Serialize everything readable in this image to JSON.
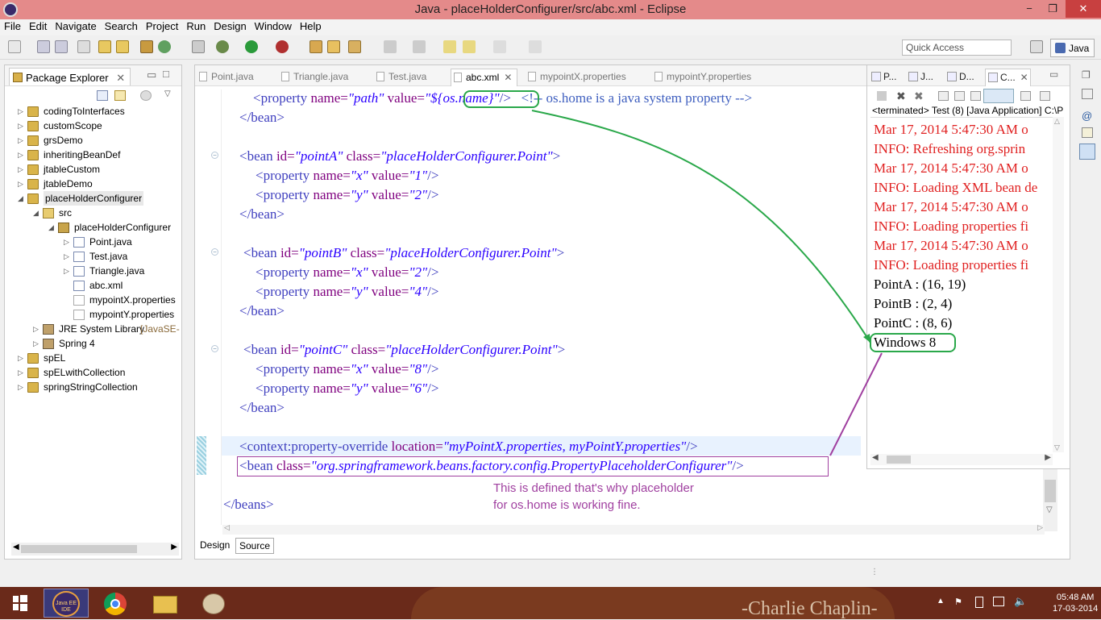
{
  "window": {
    "title": "Java - placeHolderConfigurer/src/abc.xml - Eclipse",
    "minimize": "−",
    "maximize": "❐",
    "close": "✕"
  },
  "menu": [
    "File",
    "Edit",
    "Navigate",
    "Search",
    "Project",
    "Run",
    "Design",
    "Window",
    "Help"
  ],
  "toolbar": {
    "quick_access_placeholder": "Quick Access",
    "perspective": "Java"
  },
  "package_explorer": {
    "title": "Package Explorer",
    "items": [
      {
        "label": "codingToInterfaces",
        "level": 0,
        "arrow": "▷",
        "icon": "proj"
      },
      {
        "label": "customScope",
        "level": 0,
        "arrow": "▷",
        "icon": "proj"
      },
      {
        "label": "grsDemo",
        "level": 0,
        "arrow": "▷",
        "icon": "proj"
      },
      {
        "label": "inheritingBeanDef",
        "level": 0,
        "arrow": "▷",
        "icon": "proj"
      },
      {
        "label": "jtableCustom",
        "level": 0,
        "arrow": "▷",
        "icon": "proj"
      },
      {
        "label": "jtableDemo",
        "level": 0,
        "arrow": "▷",
        "icon": "proj"
      },
      {
        "label": "placeHolderConfigurer",
        "level": 0,
        "arrow": "◢",
        "icon": "proj"
      },
      {
        "label": "src",
        "level": 1,
        "arrow": "◢",
        "icon": "srcf"
      },
      {
        "label": "placeHolderConfigurer",
        "level": 2,
        "arrow": "◢",
        "icon": "pkg"
      },
      {
        "label": "Point.java",
        "level": 3,
        "arrow": "▷",
        "icon": "java"
      },
      {
        "label": "Test.java",
        "level": 3,
        "arrow": "▷",
        "icon": "java"
      },
      {
        "label": "Triangle.java",
        "level": 3,
        "arrow": "▷",
        "icon": "java"
      },
      {
        "label": "abc.xml",
        "level": 3,
        "arrow": "",
        "icon": "xml"
      },
      {
        "label": "mypointX.properties",
        "level": 3,
        "arrow": "",
        "icon": "prop"
      },
      {
        "label": "mypointY.properties",
        "level": 3,
        "arrow": "",
        "icon": "prop"
      },
      {
        "label": "JRE System Library",
        "extra": "[JavaSE-",
        "level": 1,
        "arrow": "▷",
        "icon": "lib"
      },
      {
        "label": "Spring 4",
        "level": 1,
        "arrow": "▷",
        "icon": "lib"
      },
      {
        "label": "spEL",
        "level": 0,
        "arrow": "▷",
        "icon": "proj"
      },
      {
        "label": "spELwithCollection",
        "level": 0,
        "arrow": "▷",
        "icon": "proj"
      },
      {
        "label": "springStringCollection",
        "level": 0,
        "arrow": "▷",
        "icon": "proj"
      }
    ]
  },
  "editor": {
    "tabs": [
      "Point.java",
      "Triangle.java",
      "Test.java",
      "abc.xml",
      "mypointX.properties",
      "mypointY.properties"
    ],
    "active_tab": "abc.xml",
    "bottom_tabs": [
      "Design",
      "Source"
    ],
    "code": {
      "l1": {
        "indent": "    ",
        "open": "<property ",
        "a1": "name=",
        "v1": "\"path\"",
        "a2": " value=",
        "v2a": "\"",
        "v2b": "${os.name}",
        "v2c": "\"",
        "close": "/>",
        "comment": "   <!-- os.home is a java system property -->"
      },
      "l2": "</bean>",
      "beanA": {
        "open": "<bean ",
        "a1": "id=",
        "v1": "\"pointA\"",
        "a2": " class=",
        "v2": "\"placeHolderConfigurer.Point\"",
        "close": ">"
      },
      "pA1": {
        "open": "<property ",
        "a1": "name=",
        "v1": "\"x\"",
        "a2": " value=",
        "v2": "\"1\"",
        "close": "/>"
      },
      "pA2": {
        "open": "<property ",
        "a1": "name=",
        "v1": "\"y\"",
        "a2": " value=",
        "v2": "\"2\"",
        "close": "/>"
      },
      "endA": "</bean>",
      "beanB": {
        "open": "<bean ",
        "a1": "id=",
        "v1": "\"pointB\"",
        "a2": " class=",
        "v2": "\"placeHolderConfigurer.Point\"",
        "close": ">"
      },
      "pB1": {
        "open": "<property ",
        "a1": "name=",
        "v1": "\"x\"",
        "a2": " value=",
        "v2": "\"2\"",
        "close": "/>"
      },
      "pB2": {
        "open": "<property ",
        "a1": "name=",
        "v1": "\"y\"",
        "a2": " value=",
        "v2": "\"4\"",
        "close": "/>"
      },
      "endB": "</bean>",
      "beanC": {
        "open": "<bean ",
        "a1": "id=",
        "v1": "\"pointC\"",
        "a2": " class=",
        "v2": "\"placeHolderConfigurer.Point\"",
        "close": ">"
      },
      "pC1": {
        "open": "<property ",
        "a1": "name=",
        "v1": "\"x\"",
        "a2": " value=",
        "v2": "\"8\"",
        "close": "/>"
      },
      "pC2": {
        "open": "<property ",
        "a1": "name=",
        "v1": "\"y\"",
        "a2": " value=",
        "v2": "\"6\"",
        "close": "/>"
      },
      "endC": "</bean>",
      "ctx": {
        "open": "<context:property-override ",
        "a1": "location=",
        "v1": "\"myPointX.properties, myPointY.properties\"",
        "close": "/>"
      },
      "phc": {
        "open": "<bean ",
        "a1": "class=",
        "v1": "\"org.springframework.beans.factory.config.PropertyPlaceholderConfigurer\"",
        "close": "/>"
      },
      "endBeans": "</beans>"
    }
  },
  "console": {
    "tabs": [
      "P...",
      "J...",
      "D...",
      "C..."
    ],
    "header": "<terminated> Test (8) [Java Application] C:\\P",
    "lines": [
      {
        "text": "Mar 17, 2014 5:47:30 AM o",
        "color": "red"
      },
      {
        "text": "INFO: Refreshing org.sprin",
        "color": "red"
      },
      {
        "text": "Mar 17, 2014 5:47:30 AM o",
        "color": "red"
      },
      {
        "text": "INFO: Loading XML bean de",
        "color": "red"
      },
      {
        "text": "Mar 17, 2014 5:47:30 AM o",
        "color": "red"
      },
      {
        "text": "INFO: Loading properties fi",
        "color": "red"
      },
      {
        "text": "Mar 17, 2014 5:47:30 AM o",
        "color": "red"
      },
      {
        "text": "INFO: Loading properties fi",
        "color": "red"
      },
      {
        "text": "PointA : (16, 19)",
        "color": "black"
      },
      {
        "text": "PointB : (2, 4)",
        "color": "black"
      },
      {
        "text": "PointC : (8, 6)",
        "color": "black"
      },
      {
        "text": "Windows 8",
        "color": "black"
      }
    ]
  },
  "annotation": {
    "line1": "This is defined that's why placeholder",
    "line2": "for os.home is working fine."
  },
  "taskbar": {
    "time": "05:48 AM",
    "date": "17-03-2014",
    "wallpaper_text": "-Charlie Chaplin-",
    "eclipse_label": "Java EE IDE"
  },
  "colors": {
    "titlebar": "#e48a8a",
    "annotation_green": "#2aa84a",
    "annotation_purple": "#a040a0",
    "console_red": "#e02020"
  }
}
